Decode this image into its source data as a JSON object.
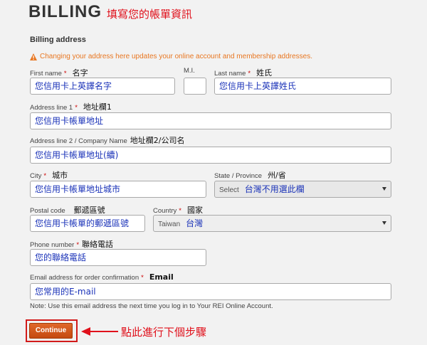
{
  "page": {
    "title": "BILLING",
    "title_annotation": "填寫您的帳單資訊",
    "section_title": "Billing address",
    "warning": "Changing your address here updates your online account and membership addresses.",
    "note": "Note: Use this email address the next time you log in to Your REI Online Account."
  },
  "form": {
    "first_name": {
      "label": "First name",
      "hint": "名字",
      "value": "您信用卡上英譯名字"
    },
    "middle_initial": {
      "label": "M.I.",
      "value": ""
    },
    "last_name": {
      "label": "Last name",
      "hint": "姓氏",
      "value": "您信用卡上英譯姓氏"
    },
    "address1": {
      "label": "Address line 1",
      "hint": "地址欄1",
      "value": "您信用卡帳單地址"
    },
    "address2": {
      "label": "Address line 2 / Company Name",
      "hint": "地址欄2/公司名",
      "value": "您信用卡帳單地址(續)"
    },
    "city": {
      "label": "City",
      "hint": "城市",
      "value": "您信用卡帳單地址城市"
    },
    "state": {
      "label": "State / Province",
      "hint": "州/省",
      "value": "Select",
      "annotation": "台灣不用選此欄"
    },
    "postal": {
      "label": "Postal code",
      "hint": "郵遞區號",
      "value": "您信用卡帳單的郵遞區號"
    },
    "country": {
      "label": "Country",
      "hint": "國家",
      "value": "Taiwan",
      "annotation": "台灣"
    },
    "phone": {
      "label": "Phone number",
      "hint": "聯絡電話",
      "value": "您的聯絡電話"
    },
    "email": {
      "label": "Email address for order confirmation",
      "hint": "Email",
      "value": "您常用的E-mail"
    }
  },
  "actions": {
    "continue_label": "Continue",
    "continue_annotation": "點此進行下個步驟"
  },
  "colors": {
    "accent": "#e87722",
    "button": "#d05a1a",
    "annotation_red": "#e0101b",
    "annotation_blue": "#1a32b8"
  }
}
